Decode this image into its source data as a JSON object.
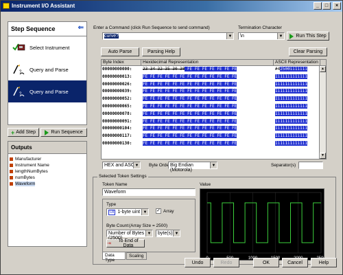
{
  "window": {
    "title": "Instrument I/O Assistant"
  },
  "left": {
    "step_sequence_label": "Step Sequence",
    "steps": [
      {
        "label": "Select Instrument",
        "selected": false
      },
      {
        "label": "Query and Parse",
        "selected": false
      },
      {
        "label": "Query and Parse",
        "selected": true
      }
    ],
    "add_step_label": "Add Step",
    "run_sequence_label": "Run Sequence",
    "outputs_label": "Outputs",
    "outputs": [
      "Manufacturer",
      "Instrument Name",
      "lengthNumBytes",
      "numBytes",
      "Waveform"
    ]
  },
  "command": {
    "label": "Enter a Command (click Run Sequence to send command)",
    "value": "curve?",
    "termination_label": "Termination Character",
    "termination_value": "\\n",
    "run_step_label": "Run This Step"
  },
  "parse": {
    "auto_parse_label": "Auto Parse",
    "parsing_help_label": "Parsing Help",
    "clear_parsing_label": "Clear Parsing"
  },
  "hex_table": {
    "col_index": "Byte Index",
    "col_hex": "Hexidecimal Representation",
    "col_ascii": "ASCII Representation",
    "rows": [
      {
        "idx": "00000000000:",
        "hex_plain": "23 34 32 35 30 30",
        "hex_hl": " FE FE FE FE FE FE FE",
        "asc_plain": "#4",
        "asc_hl": "2500ii1ii1i"
      },
      {
        "idx": "00000000013:",
        "hex_plain": "",
        "hex_hl": "FE FE FE FE FE FE FE FE FE FE FE FE FE",
        "asc_plain": "",
        "asc_hl": "1i1i1i1i1i1i1"
      },
      {
        "idx": "00000000026:",
        "hex_plain": "",
        "hex_hl": "FE FE FE FE FE FE FE FE FE FE FE FE FE",
        "asc_plain": "",
        "asc_hl": "1i1i1i1i1i1i1"
      },
      {
        "idx": "00000000039:",
        "hex_plain": "",
        "hex_hl": "FE FE FE FE FE FE FE FE FE FE FE FE FE",
        "asc_plain": "",
        "asc_hl": "1i1i1i1i1i1i1"
      },
      {
        "idx": "00000000052:",
        "hex_plain": "",
        "hex_hl": "FE FE FE FE FE FE FE FE FE FE FE FE FE",
        "asc_plain": "",
        "asc_hl": "1i1i1i1i1i1i1"
      },
      {
        "idx": "00000000065:",
        "hex_plain": "",
        "hex_hl": "FE FE FE FE FE FE FE FE FE FE FE FE FE",
        "asc_plain": "",
        "asc_hl": "1i1i1i1i1i1i1"
      },
      {
        "idx": "00000000078:",
        "hex_plain": "",
        "hex_hl": "FE FE FE FE FE FE FE FE FE FE FE FE FE",
        "asc_plain": "",
        "asc_hl": "1i1i1i1i1i1i1"
      },
      {
        "idx": "00000000091:",
        "hex_plain": "",
        "hex_hl": "FE FE FE FE FE FE FE FE FE FE FE FE FE",
        "asc_plain": "",
        "asc_hl": "1i1i1i1i1i1i1"
      },
      {
        "idx": "00000000104:",
        "hex_plain": "",
        "hex_hl": "FE FE FE FE FE FE FE FE FE FE FE FE FE",
        "asc_plain": "",
        "asc_hl": "1i1i1i1i1i1i1"
      },
      {
        "idx": "00000000117:",
        "hex_plain": "",
        "hex_hl": "FE FE FE FE FE FE FE FE FE FE FE FE FE",
        "asc_plain": "",
        "asc_hl": "1i1i1i1i1i1i1"
      },
      {
        "idx": "00000000130:",
        "hex_plain": "",
        "hex_hl": "FE FE FE FE FE FE FE FE FE FE FE FE FE",
        "asc_plain": "",
        "asc_hl": "1i1i1i1i1i1i1"
      }
    ]
  },
  "display": {
    "format_value": "HEX and ASCII",
    "byte_order_label": "Byte Order",
    "byte_order_value": "Big Endian (Motorola)",
    "separator_label": "Separator(s)",
    "separator_value": ""
  },
  "token": {
    "group_title": "Selected Token Settings",
    "name_label": "Token Name",
    "name_value": "Waveform",
    "type_label": "Type",
    "type_badge": "U8",
    "type_value": "1-byte uint",
    "array_label": "Array",
    "array_checked": true,
    "byte_count_label": "Byte Count",
    "array_size_label": "(Array Size = 2500)",
    "byte_count_value": "Number of Bytes (2500)",
    "byte_unit_value": "byte(s)",
    "to_end_label": "To End of Data",
    "tab_data_type": "Data Type",
    "tab_scaling": "Scaling",
    "value_label": "Value"
  },
  "footer": {
    "undo": "Undo",
    "redo": "Redo",
    "ok": "OK",
    "cancel": "Cancel",
    "help": "Help"
  },
  "chart_data": {
    "type": "line",
    "title": "",
    "xlabel": "",
    "ylabel": "",
    "xlim": [
      0,
      2500
    ],
    "ylim": [
      0,
      1
    ],
    "x_ticks": [
      "0",
      "500",
      "1000",
      "1500",
      "2000",
      "2500"
    ],
    "grid": true,
    "series": [
      {
        "color": "#3cd23c",
        "x": [
          0,
          80,
          80,
          330,
          330,
          580,
          580,
          830,
          830,
          1080,
          1080,
          1330,
          1330,
          1580,
          1580,
          1830,
          1830,
          2080,
          2080,
          2330,
          2330,
          2500
        ],
        "y": [
          0.83,
          0.83,
          0.17,
          0.17,
          0.83,
          0.83,
          0.17,
          0.17,
          0.83,
          0.83,
          0.17,
          0.17,
          0.83,
          0.83,
          0.17,
          0.17,
          0.83,
          0.83,
          0.17,
          0.17,
          0.83,
          0.83
        ]
      }
    ]
  },
  "colors": {
    "selection": "#0a246a",
    "highlight": "#2030d0",
    "accent_green": "#1a9a1a",
    "plot_bg": "#000000",
    "trace": "#3cd23c"
  }
}
